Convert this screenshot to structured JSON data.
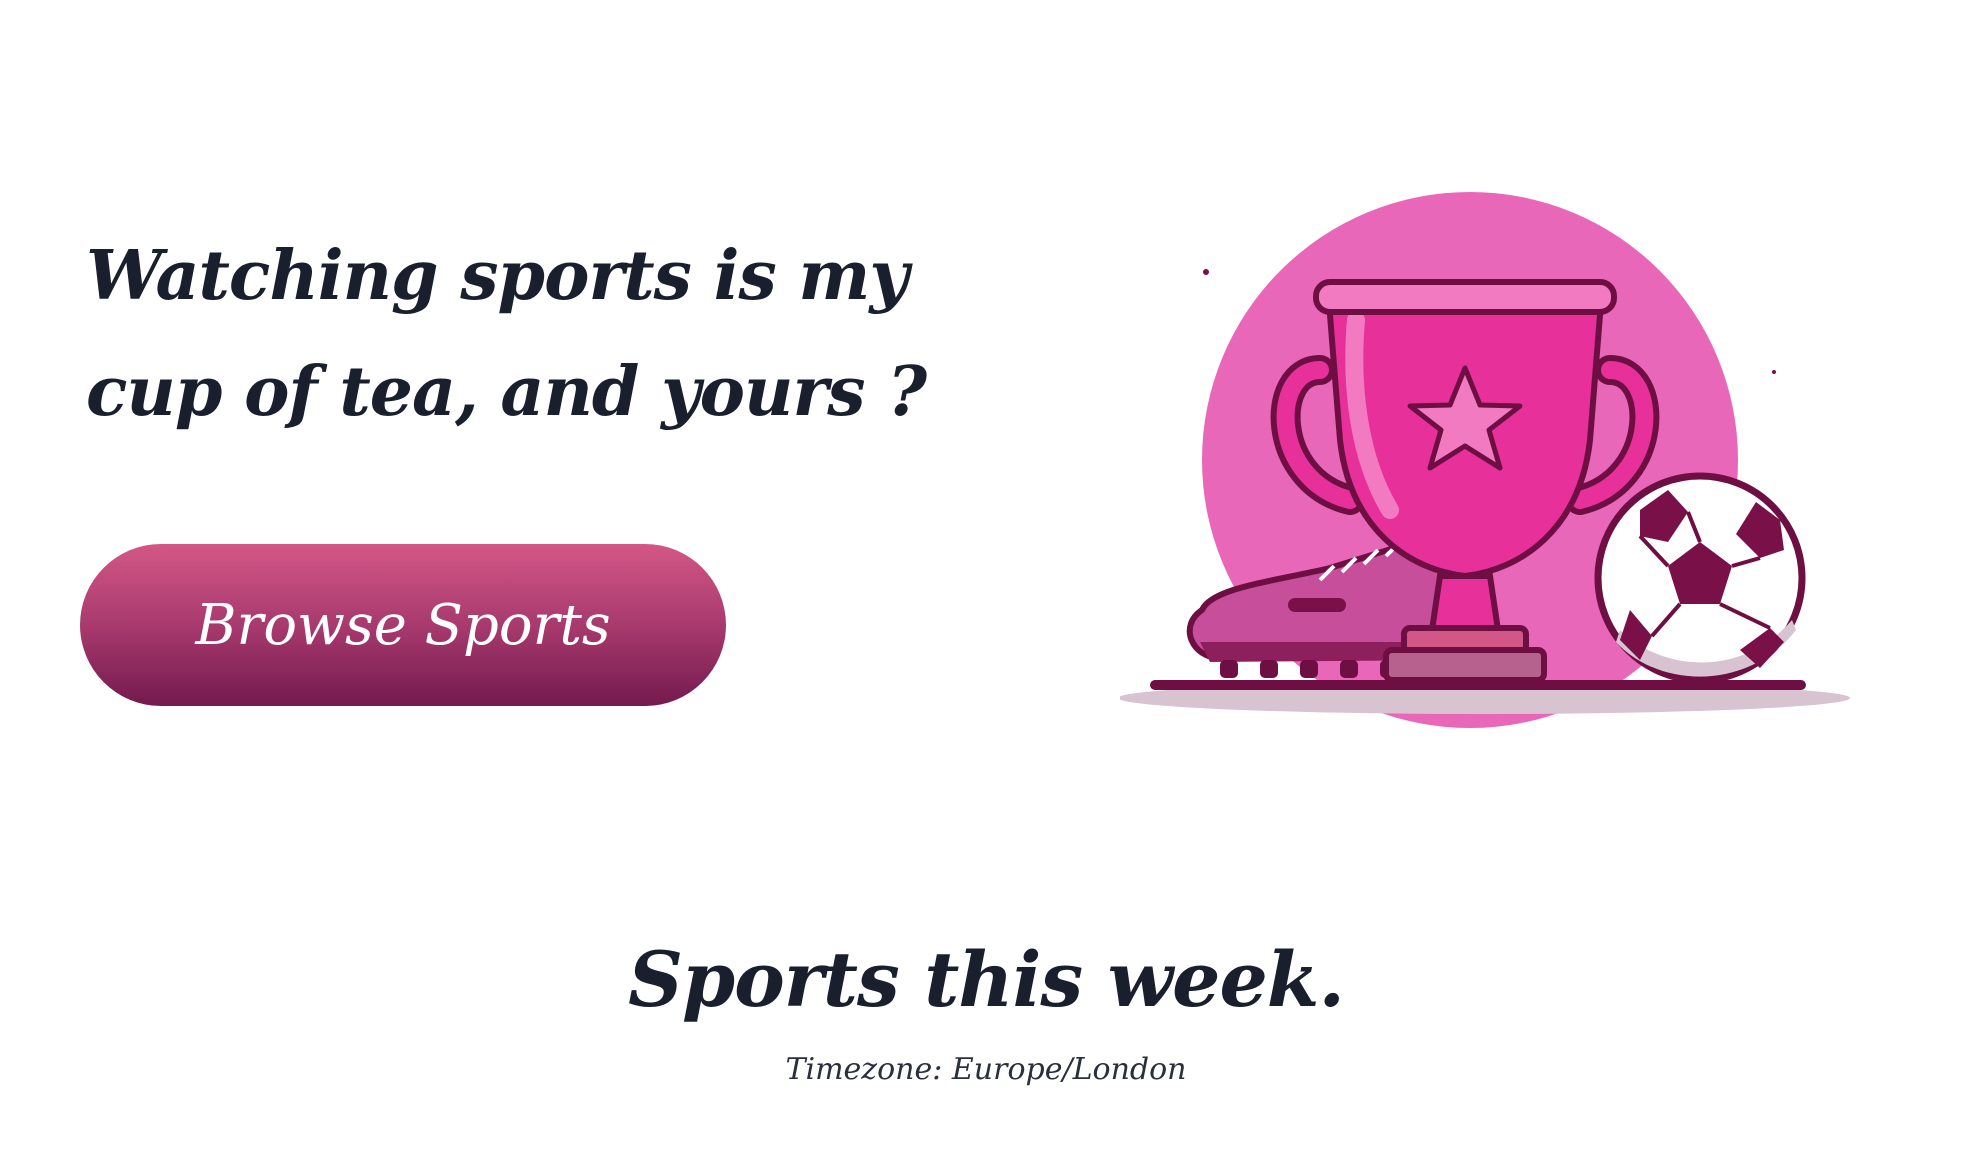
{
  "hero": {
    "title": "Watching sports is my cup of tea, and yours ?",
    "cta_label": "Browse Sports",
    "illustration_icons": [
      "trophy-icon",
      "football-boot-icon",
      "soccer-ball-icon"
    ]
  },
  "schedule": {
    "title": "Sports this week.",
    "timezone": "Timezone: Europe/London"
  },
  "colors": {
    "text": "#1a1f2e",
    "button_top": "#d35786",
    "button_bottom": "#741a4e",
    "accent_pink": "#e867b9",
    "trophy": "#e8309a"
  }
}
